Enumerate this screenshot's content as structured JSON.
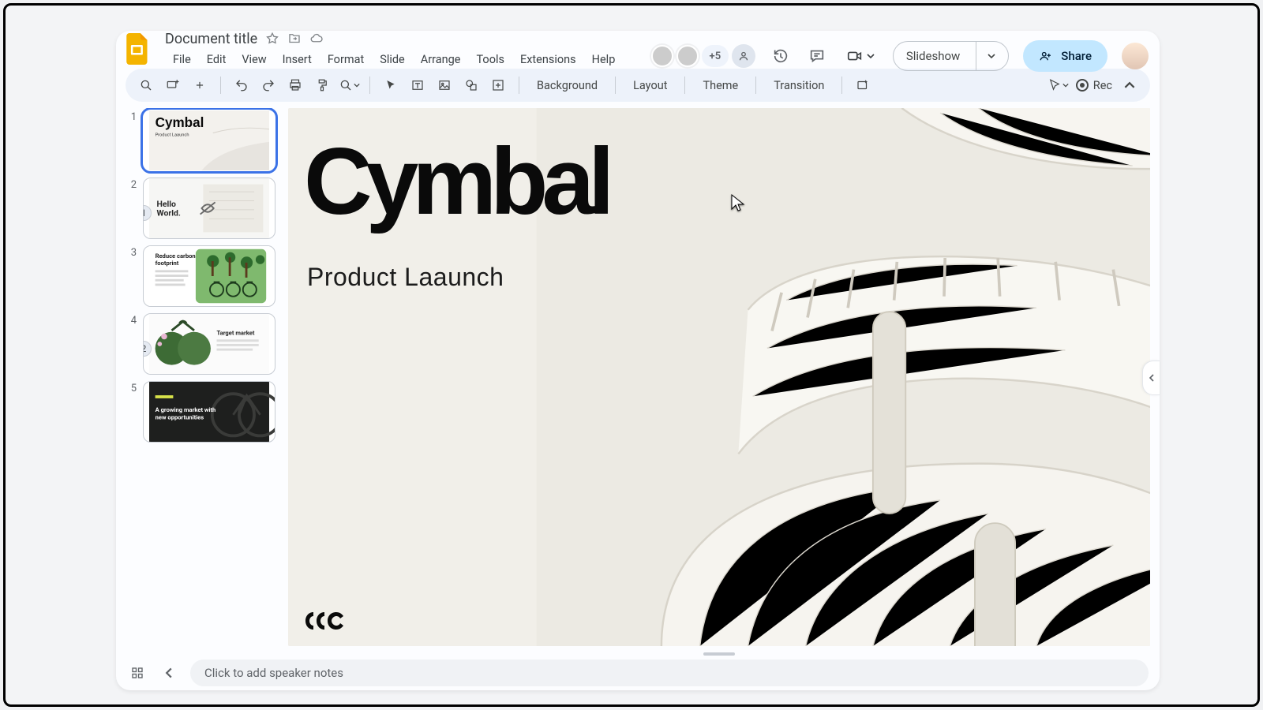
{
  "header": {
    "title": "Document title",
    "menus": [
      "File",
      "Edit",
      "View",
      "Insert",
      "Format",
      "Slide",
      "Arrange",
      "Tools",
      "Extensions",
      "Help"
    ],
    "more_collab": "+5",
    "slideshow": "Slideshow",
    "share": "Share"
  },
  "toolbar": {
    "background": "Background",
    "layout": "Layout",
    "theme": "Theme",
    "transition": "Transition",
    "rec": "Rec"
  },
  "thumbs": [
    {
      "num": "1",
      "title": "Cymbal",
      "sub": "Product Laaunch",
      "selected": true
    },
    {
      "num": "2",
      "title": "Hello World.",
      "sub": "",
      "badge": "1"
    },
    {
      "num": "3",
      "title": "Reduce carbon footprint",
      "sub": ""
    },
    {
      "num": "4",
      "title": "Target market",
      "sub": "",
      "badge": "2"
    },
    {
      "num": "5",
      "title": "A growing market with new opportunities",
      "sub": ""
    }
  ],
  "slide": {
    "title": "Cymbal",
    "subtitle": "Product Laaunch"
  },
  "footer": {
    "notes": "Click to add speaker notes"
  }
}
